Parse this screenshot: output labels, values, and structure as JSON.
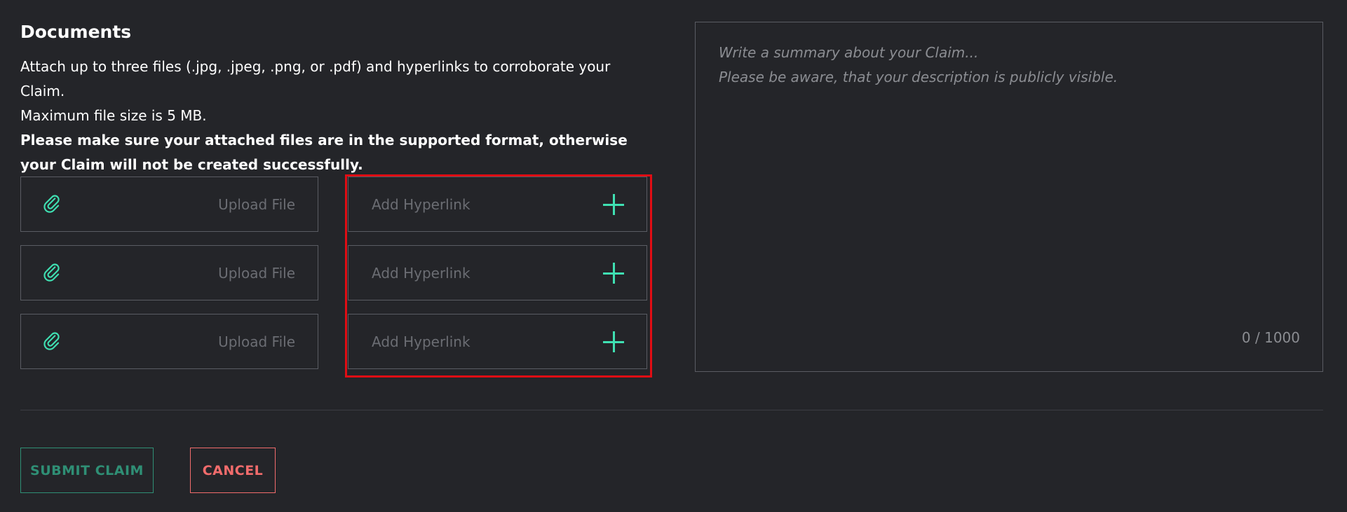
{
  "documents": {
    "title": "Documents",
    "line1": "Attach up to three files (.jpg, .jpeg, .png, or .pdf) and hyperlinks to corroborate your Claim.",
    "line2": "Maximum file size is 5 MB.",
    "warning": "Please make sure your attached files are in the supported format, otherwise your Claim will not be created successfully."
  },
  "rows": [
    {
      "upload_label": "Upload File",
      "link_placeholder": "Add Hyperlink"
    },
    {
      "upload_label": "Upload File",
      "link_placeholder": "Add Hyperlink"
    },
    {
      "upload_label": "Upload File",
      "link_placeholder": "Add Hyperlink"
    }
  ],
  "icons": {
    "attach": "paperclip-icon",
    "add": "plus-icon"
  },
  "summary": {
    "placeholder": "Write a summary about your Claim...\nPlease be aware, that your description is publicly visible.",
    "counter": "0 / 1000"
  },
  "actions": {
    "submit_label": "SUBMIT CLAIM",
    "cancel_label": "CANCEL"
  },
  "colors": {
    "background": "#242529",
    "accent": "#3fe0b2",
    "submit": "#2f8f75",
    "cancel": "#f26c6c",
    "highlight": "#e00d14"
  }
}
